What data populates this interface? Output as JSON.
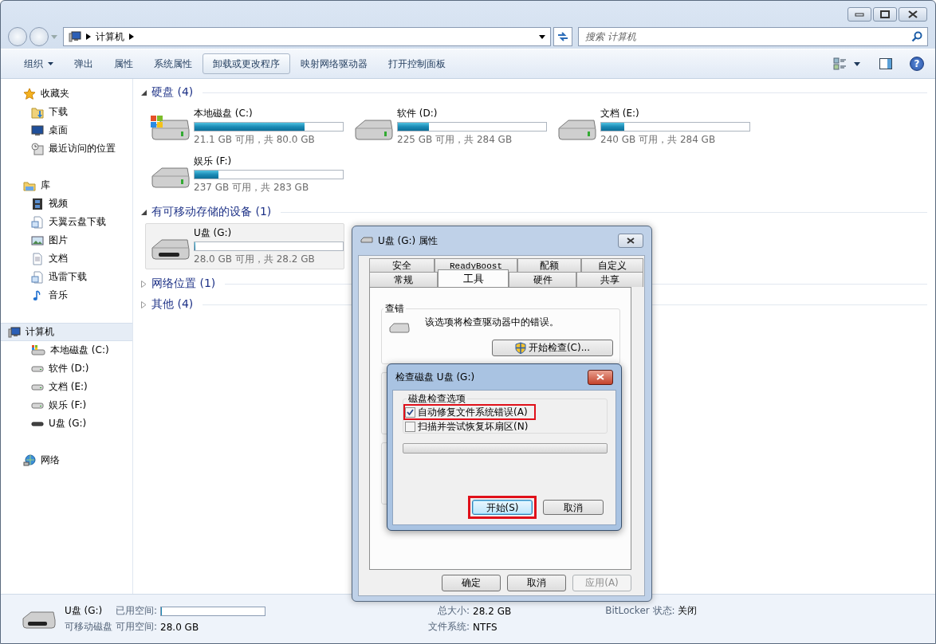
{
  "address_bar": {
    "path": [
      "计算机"
    ]
  },
  "search": {
    "placeholder": "搜索 计算机"
  },
  "toolbar": {
    "buttons": [
      {
        "label": "组织",
        "dropdown": true,
        "hovered": false
      },
      {
        "label": "弹出",
        "dropdown": false,
        "hovered": false
      },
      {
        "label": "属性",
        "dropdown": false,
        "hovered": false
      },
      {
        "label": "系统属性",
        "dropdown": false,
        "hovered": false
      },
      {
        "label": "卸载或更改程序",
        "dropdown": false,
        "hovered": true
      },
      {
        "label": "映射网络驱动器",
        "dropdown": false,
        "hovered": false
      },
      {
        "label": "打开控制面板",
        "dropdown": false,
        "hovered": false
      }
    ],
    "help_button": {
      "label": "?"
    }
  },
  "sidebar": {
    "groups": [
      {
        "label": "收藏夹",
        "kind": "star",
        "selected": false,
        "children": [
          {
            "label": "下载",
            "kind": "download",
            "selected": false
          },
          {
            "label": "桌面",
            "kind": "desktop",
            "selected": false
          },
          {
            "label": "最近访问的位置",
            "kind": "recent",
            "selected": false
          }
        ]
      },
      {
        "label": "库",
        "kind": "library",
        "selected": false,
        "children": [
          {
            "label": "视频",
            "kind": "video",
            "selected": false
          },
          {
            "label": "天翼云盘下载",
            "kind": "libfolder",
            "selected": false
          },
          {
            "label": "图片",
            "kind": "picture",
            "selected": false
          },
          {
            "label": "文档",
            "kind": "document",
            "selected": false
          },
          {
            "label": "迅雷下载",
            "kind": "libfolder",
            "selected": false
          },
          {
            "label": "音乐",
            "kind": "music",
            "selected": false
          }
        ]
      },
      {
        "label": "计算机",
        "kind": "computer",
        "selected": true,
        "children": [
          {
            "label": "本地磁盘 (C:)",
            "kind": "sysdrive",
            "selected": false
          },
          {
            "label": "软件 (D:)",
            "kind": "drive",
            "selected": false
          },
          {
            "label": "文档 (E:)",
            "kind": "drive",
            "selected": false
          },
          {
            "label": "娱乐 (F:)",
            "kind": "drive",
            "selected": false
          },
          {
            "label": "U盘 (G:)",
            "kind": "usb",
            "selected": false
          }
        ]
      },
      {
        "label": "网络",
        "kind": "network",
        "selected": false
      }
    ]
  },
  "sections": [
    {
      "title": "硬盘 (4)",
      "expanded": true,
      "drives": [
        {
          "name": "本地磁盘 (C:)",
          "kind": "sysdrive",
          "level": 0.74,
          "space": "21.1 GB 可用，共 80.0 GB",
          "selected": false
        },
        {
          "name": "软件 (D:)",
          "kind": "drive",
          "level": 0.21,
          "space": "225 GB 可用，共 284 GB",
          "selected": false
        },
        {
          "name": "文档 (E:)",
          "kind": "drive",
          "level": 0.155,
          "space": "240 GB 可用，共 284 GB",
          "selected": false
        },
        {
          "name": "娱乐 (F:)",
          "kind": "drive",
          "level": 0.16,
          "space": "237 GB 可用，共 283 GB",
          "selected": false
        }
      ]
    },
    {
      "title": "有可移动存储的设备 (1)",
      "expanded": true,
      "drives": [
        {
          "name": "U盘 (G:)",
          "kind": "usb",
          "level": 0.008,
          "space": "28.0 GB 可用，共 28.2 GB",
          "selected": true
        }
      ]
    },
    {
      "title": "网络位置 (1)",
      "expanded": false
    },
    {
      "title": "其他 (4)",
      "expanded": false
    }
  ],
  "status_bar": {
    "name": "U盘 (G:)",
    "type": "可移动磁盘",
    "used_label": "已用空间:",
    "level": 0.008,
    "free_label": "可用空间:",
    "free_value": "28.0 GB",
    "total_label": "总大小:",
    "total_value": "28.2 GB",
    "fs_label": "文件系统:",
    "fs_value": "NTFS",
    "bitlocker_label": "BitLocker 状态:",
    "bitlocker_value": "关闭"
  },
  "properties_dialog": {
    "title": "U盘 (G:) 属性",
    "tab_rows": [
      [
        {
          "label": "安全",
          "selected": false
        },
        {
          "label": "ReadyBoost",
          "selected": false
        },
        {
          "label": "配额",
          "selected": false
        },
        {
          "label": "自定义",
          "selected": false
        }
      ],
      [
        {
          "label": "常规",
          "selected": false
        },
        {
          "label": "工具",
          "selected": true
        },
        {
          "label": "硬件",
          "selected": false
        },
        {
          "label": "共享",
          "selected": false
        }
      ]
    ],
    "error_check": {
      "title": "查错",
      "text": "该选项将检查驱动器中的错误。",
      "button": "开始检查(C)..."
    },
    "buttons": [
      {
        "label": "确定",
        "disabled": false
      },
      {
        "label": "取消",
        "disabled": false
      },
      {
        "label": "应用(A)",
        "disabled": true
      }
    ]
  },
  "check_disk_dialog": {
    "title": "检查磁盘 U盘 (G:)",
    "group": "磁盘检查选项",
    "options": [
      {
        "label": "自动修复文件系统错误(A)",
        "checked": true,
        "highlighted": true
      },
      {
        "label": "扫描并尝试恢复坏扇区(N)",
        "checked": false,
        "highlighted": false
      }
    ],
    "progress": {
      "level": 0
    },
    "buttons": [
      {
        "label": "开始(S)",
        "default": true,
        "highlighted": true
      },
      {
        "label": "取消",
        "default": false,
        "highlighted": false
      }
    ]
  }
}
